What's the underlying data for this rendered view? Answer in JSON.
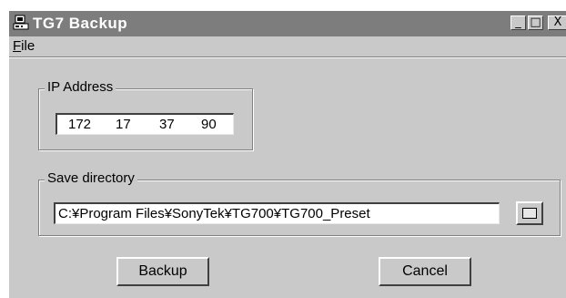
{
  "window": {
    "title": "TG7 Backup",
    "app_icon": "computer-icon",
    "controls": {
      "minimize_glyph": "_",
      "maximize_glyph": "□",
      "close_glyph": "X"
    }
  },
  "menu": {
    "file": {
      "mnemonic": "F",
      "rest": "ile"
    }
  },
  "ip_group": {
    "label": "IP Address",
    "octets": [
      "172",
      "17",
      "37",
      "90"
    ]
  },
  "dir_group": {
    "label": "Save directory",
    "path": "C:¥Program Files¥SonyTek¥TG700¥TG700_Preset",
    "browse_icon": "browse-icon"
  },
  "buttons": {
    "backup": "Backup",
    "cancel": "Cancel"
  },
  "colors": {
    "titlebar": "#7d7d7d",
    "face": "#c9c9c9",
    "field": "#ffffff"
  }
}
